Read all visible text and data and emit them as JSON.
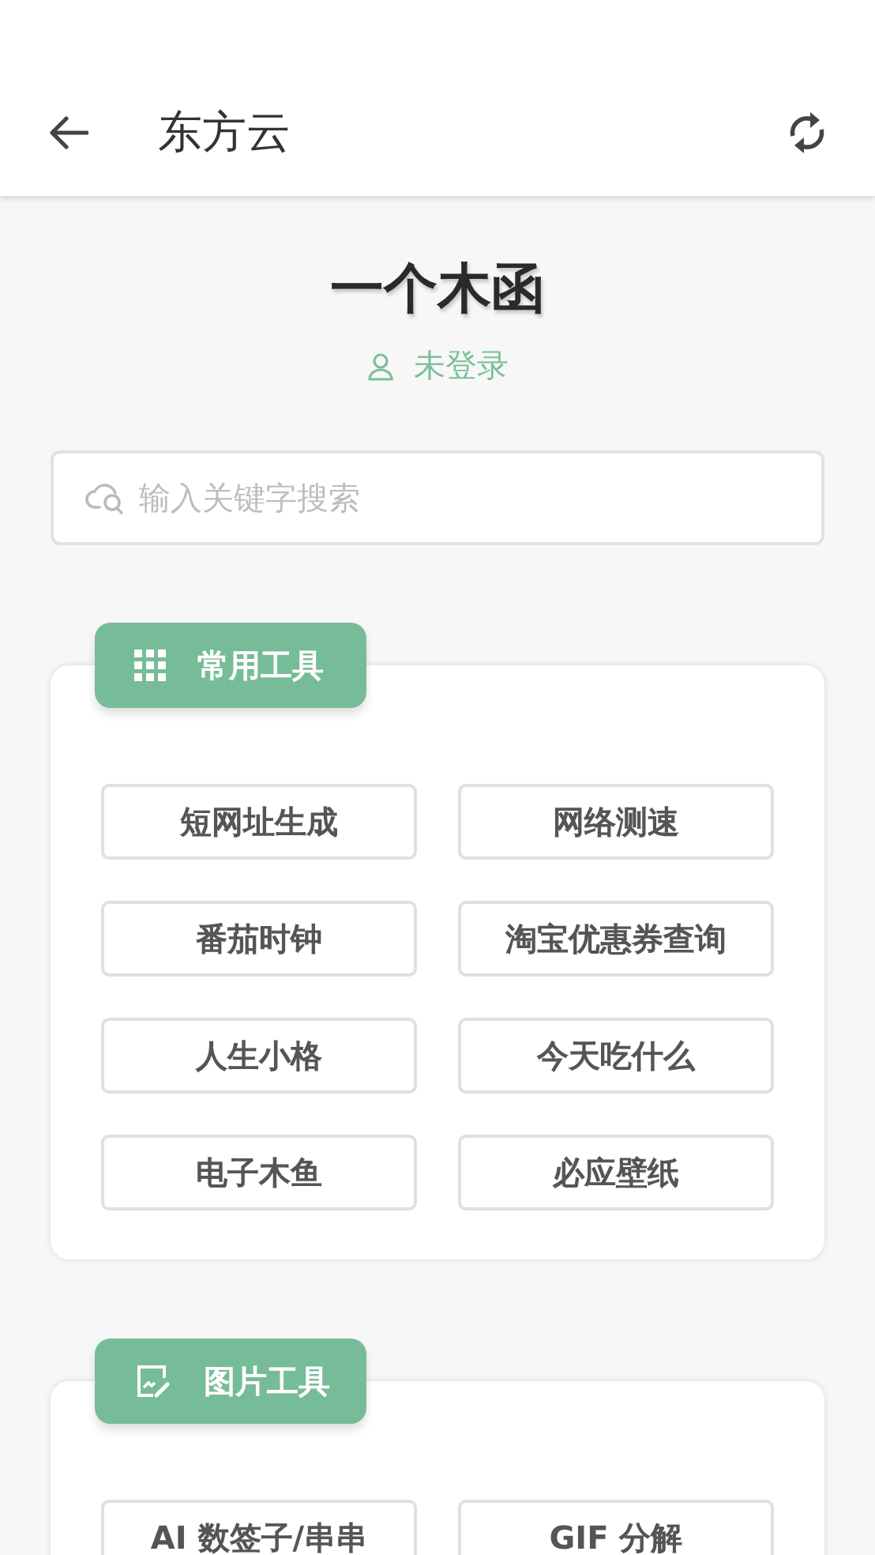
{
  "header": {
    "title": "东方云"
  },
  "profile": {
    "name": "一个木函",
    "login_status": "未登录"
  },
  "search": {
    "placeholder": "输入关键字搜索"
  },
  "sections": [
    {
      "kind": "grid",
      "title": "常用工具",
      "tools": [
        "短网址生成",
        "网络测速",
        "番茄时钟",
        "淘宝优惠券查询",
        "人生小格",
        "今天吃什么",
        "电子木鱼",
        "必应壁纸"
      ]
    },
    {
      "kind": "image",
      "title": "图片工具",
      "tools": [
        "AI 数签子/串串",
        "GIF 分解"
      ]
    }
  ]
}
